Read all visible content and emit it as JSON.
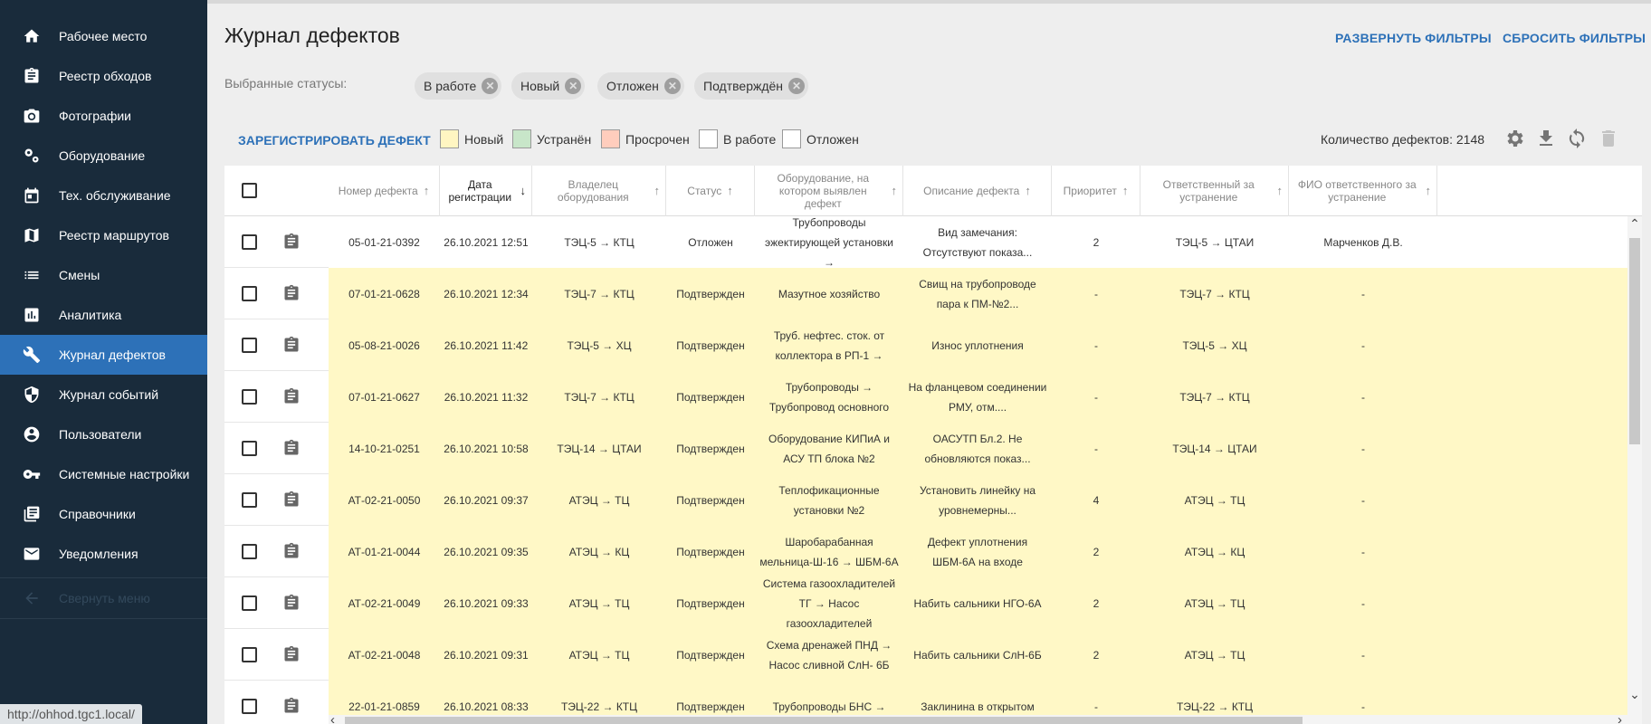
{
  "sidebar": {
    "items": [
      {
        "label": "Рабочее место",
        "icon": "home-icon"
      },
      {
        "label": "Реестр обходов",
        "icon": "clipboard-icon"
      },
      {
        "label": "Фотографии",
        "icon": "camera-icon"
      },
      {
        "label": "Оборудование",
        "icon": "gears-icon"
      },
      {
        "label": "Тех. обслуживание",
        "icon": "calendar-icon"
      },
      {
        "label": "Реестр маршрутов",
        "icon": "map-icon"
      },
      {
        "label": "Смены",
        "icon": "list-icon"
      },
      {
        "label": "Аналитика",
        "icon": "chart-icon"
      },
      {
        "label": "Журнал дефектов",
        "icon": "wrench-icon",
        "active": true
      },
      {
        "label": "Журнал событий",
        "icon": "shield-icon"
      },
      {
        "label": "Пользователи",
        "icon": "user-icon"
      },
      {
        "label": "Системные настройки",
        "icon": "key-icon"
      },
      {
        "label": "Справочники",
        "icon": "books-icon"
      },
      {
        "label": "Уведомления",
        "icon": "mail-icon"
      }
    ],
    "collapse_label": "Свернуть меню",
    "status_url": "http://ohhod.tgc1.local/"
  },
  "header": {
    "title": "Журнал дефектов",
    "expand_filters": "РАЗВЕРНУТЬ ФИЛЬТРЫ",
    "reset_filters": "СБРОСИТЬ ФИЛЬТРЫ",
    "statuses_label": "Выбранные статусы:",
    "chips": [
      "В работе",
      "Новый",
      "Отложен",
      "Подтверждён"
    ]
  },
  "toolbar": {
    "register_label": "ЗАРЕГИСТРИРОВАТЬ ДЕФЕКТ",
    "legend": [
      {
        "label": "Новый",
        "color": "#fff6c2"
      },
      {
        "label": "Устранён",
        "color": "#c8e6c9"
      },
      {
        "label": "Просрочен",
        "color": "#ffcdbd"
      },
      {
        "label": "В работе",
        "color": "#ffffff"
      },
      {
        "label": "Отложен",
        "color": "#ffffff"
      }
    ],
    "count_label": "Количество дефектов: 2148"
  },
  "table": {
    "columns": [
      "Номер дефекта",
      "Дата регистрации",
      "Владелец оборудования",
      "Статус",
      "Оборудование, на котором выявлен дефект",
      "Описание дефекта",
      "Приоритет",
      "Ответственный за устранение",
      "ФИО ответственного за устранение"
    ],
    "rows": [
      {
        "num": "05-01-21-0392",
        "date": "26.10.2021 12:51",
        "owner": "ТЭЦ-5 → КТЦ",
        "status": "Отложен",
        "equip": "Трубопроводы эжектирующей установки →",
        "desc": "Вид замечания: Отсутствуют показа...",
        "priority": "2",
        "resp": "ТЭЦ-5 → ЦТАИ",
        "fio": "Марченков Д.В.",
        "color": "#ffffff"
      },
      {
        "num": "07-01-21-0628",
        "date": "26.10.2021 12:34",
        "owner": "ТЭЦ-7 → КТЦ",
        "status": "Подтвержден",
        "equip": "Мазутное хозяйство",
        "desc": "Свищ на трубопроводе пара к ПМ-№2...",
        "priority": "-",
        "resp": "ТЭЦ-7 → КТЦ",
        "fio": "-",
        "color": "#fff8c6"
      },
      {
        "num": "05-08-21-0026",
        "date": "26.10.2021 11:42",
        "owner": "ТЭЦ-5 → ХЦ",
        "status": "Подтвержден",
        "equip": "Труб. нефтес. сток. от коллектора в РП-1 →",
        "desc": "Износ уплотнения",
        "priority": "-",
        "resp": "ТЭЦ-5 → ХЦ",
        "fio": "-",
        "color": "#fff8c6"
      },
      {
        "num": "07-01-21-0627",
        "date": "26.10.2021 11:32",
        "owner": "ТЭЦ-7 → КТЦ",
        "status": "Подтвержден",
        "equip": "Трубопроводы → Трубопровод основного",
        "desc": "На фланцевом соединении РМУ, отм....",
        "priority": "-",
        "resp": "ТЭЦ-7 → КТЦ",
        "fio": "-",
        "color": "#fff8c6"
      },
      {
        "num": "14-10-21-0251",
        "date": "26.10.2021 10:58",
        "owner": "ТЭЦ-14 → ЦТАИ",
        "status": "Подтвержден",
        "equip": "Оборудование КИПиА и АСУ ТП блока №2",
        "desc": "ОАСУТП Бл.2. Не обновляются показ...",
        "priority": "-",
        "resp": "ТЭЦ-14 → ЦТАИ",
        "fio": "-",
        "color": "#fff8c6"
      },
      {
        "num": "АТ-02-21-0050",
        "date": "26.10.2021 09:37",
        "owner": "АТЭЦ → ТЦ",
        "status": "Подтвержден",
        "equip": "Теплофикационные установки №2",
        "desc": "Установить линейку на уровнемерны...",
        "priority": "4",
        "resp": "АТЭЦ → ТЦ",
        "fio": "-",
        "color": "#fff8c6"
      },
      {
        "num": "АТ-01-21-0044",
        "date": "26.10.2021 09:35",
        "owner": "АТЭЦ → КЦ",
        "status": "Подтвержден",
        "equip": "Шаробарабанная мельница-Ш-16 → ШБМ-6А",
        "desc": "Дефект уплотнения ШБМ-6А на входе",
        "priority": "2",
        "resp": "АТЭЦ → КЦ",
        "fio": "-",
        "color": "#fff8c6"
      },
      {
        "num": "АТ-02-21-0049",
        "date": "26.10.2021 09:33",
        "owner": "АТЭЦ → ТЦ",
        "status": "Подтвержден",
        "equip": "Система газоохладителей ТГ → Насос газоохладителей",
        "desc": "Набить сальники НГО-6А",
        "priority": "2",
        "resp": "АТЭЦ → ТЦ",
        "fio": "-",
        "color": "#fff8c6"
      },
      {
        "num": "АТ-02-21-0048",
        "date": "26.10.2021 09:31",
        "owner": "АТЭЦ → ТЦ",
        "status": "Подтвержден",
        "equip": "Схема дренажей ПНД → Насос сливной СлН- 6Б",
        "desc": "Набить сальники СлН-6Б",
        "priority": "2",
        "resp": "АТЭЦ → ТЦ",
        "fio": "-",
        "color": "#fff8c6"
      },
      {
        "num": "22-01-21-0859",
        "date": "26.10.2021 08:33",
        "owner": "ТЭЦ-22 → КТЦ",
        "status": "Подтвержден",
        "equip": "Трубопроводы БНС →",
        "desc": "Заклинина в открытом",
        "priority": "-",
        "resp": "ТЭЦ-22 → КТЦ",
        "fio": "-",
        "color": "#fff8c6"
      }
    ]
  },
  "colors": {
    "sidebar_bg": "#192b3b",
    "accent": "#2d71b8",
    "new_row": "#fff8c6"
  }
}
